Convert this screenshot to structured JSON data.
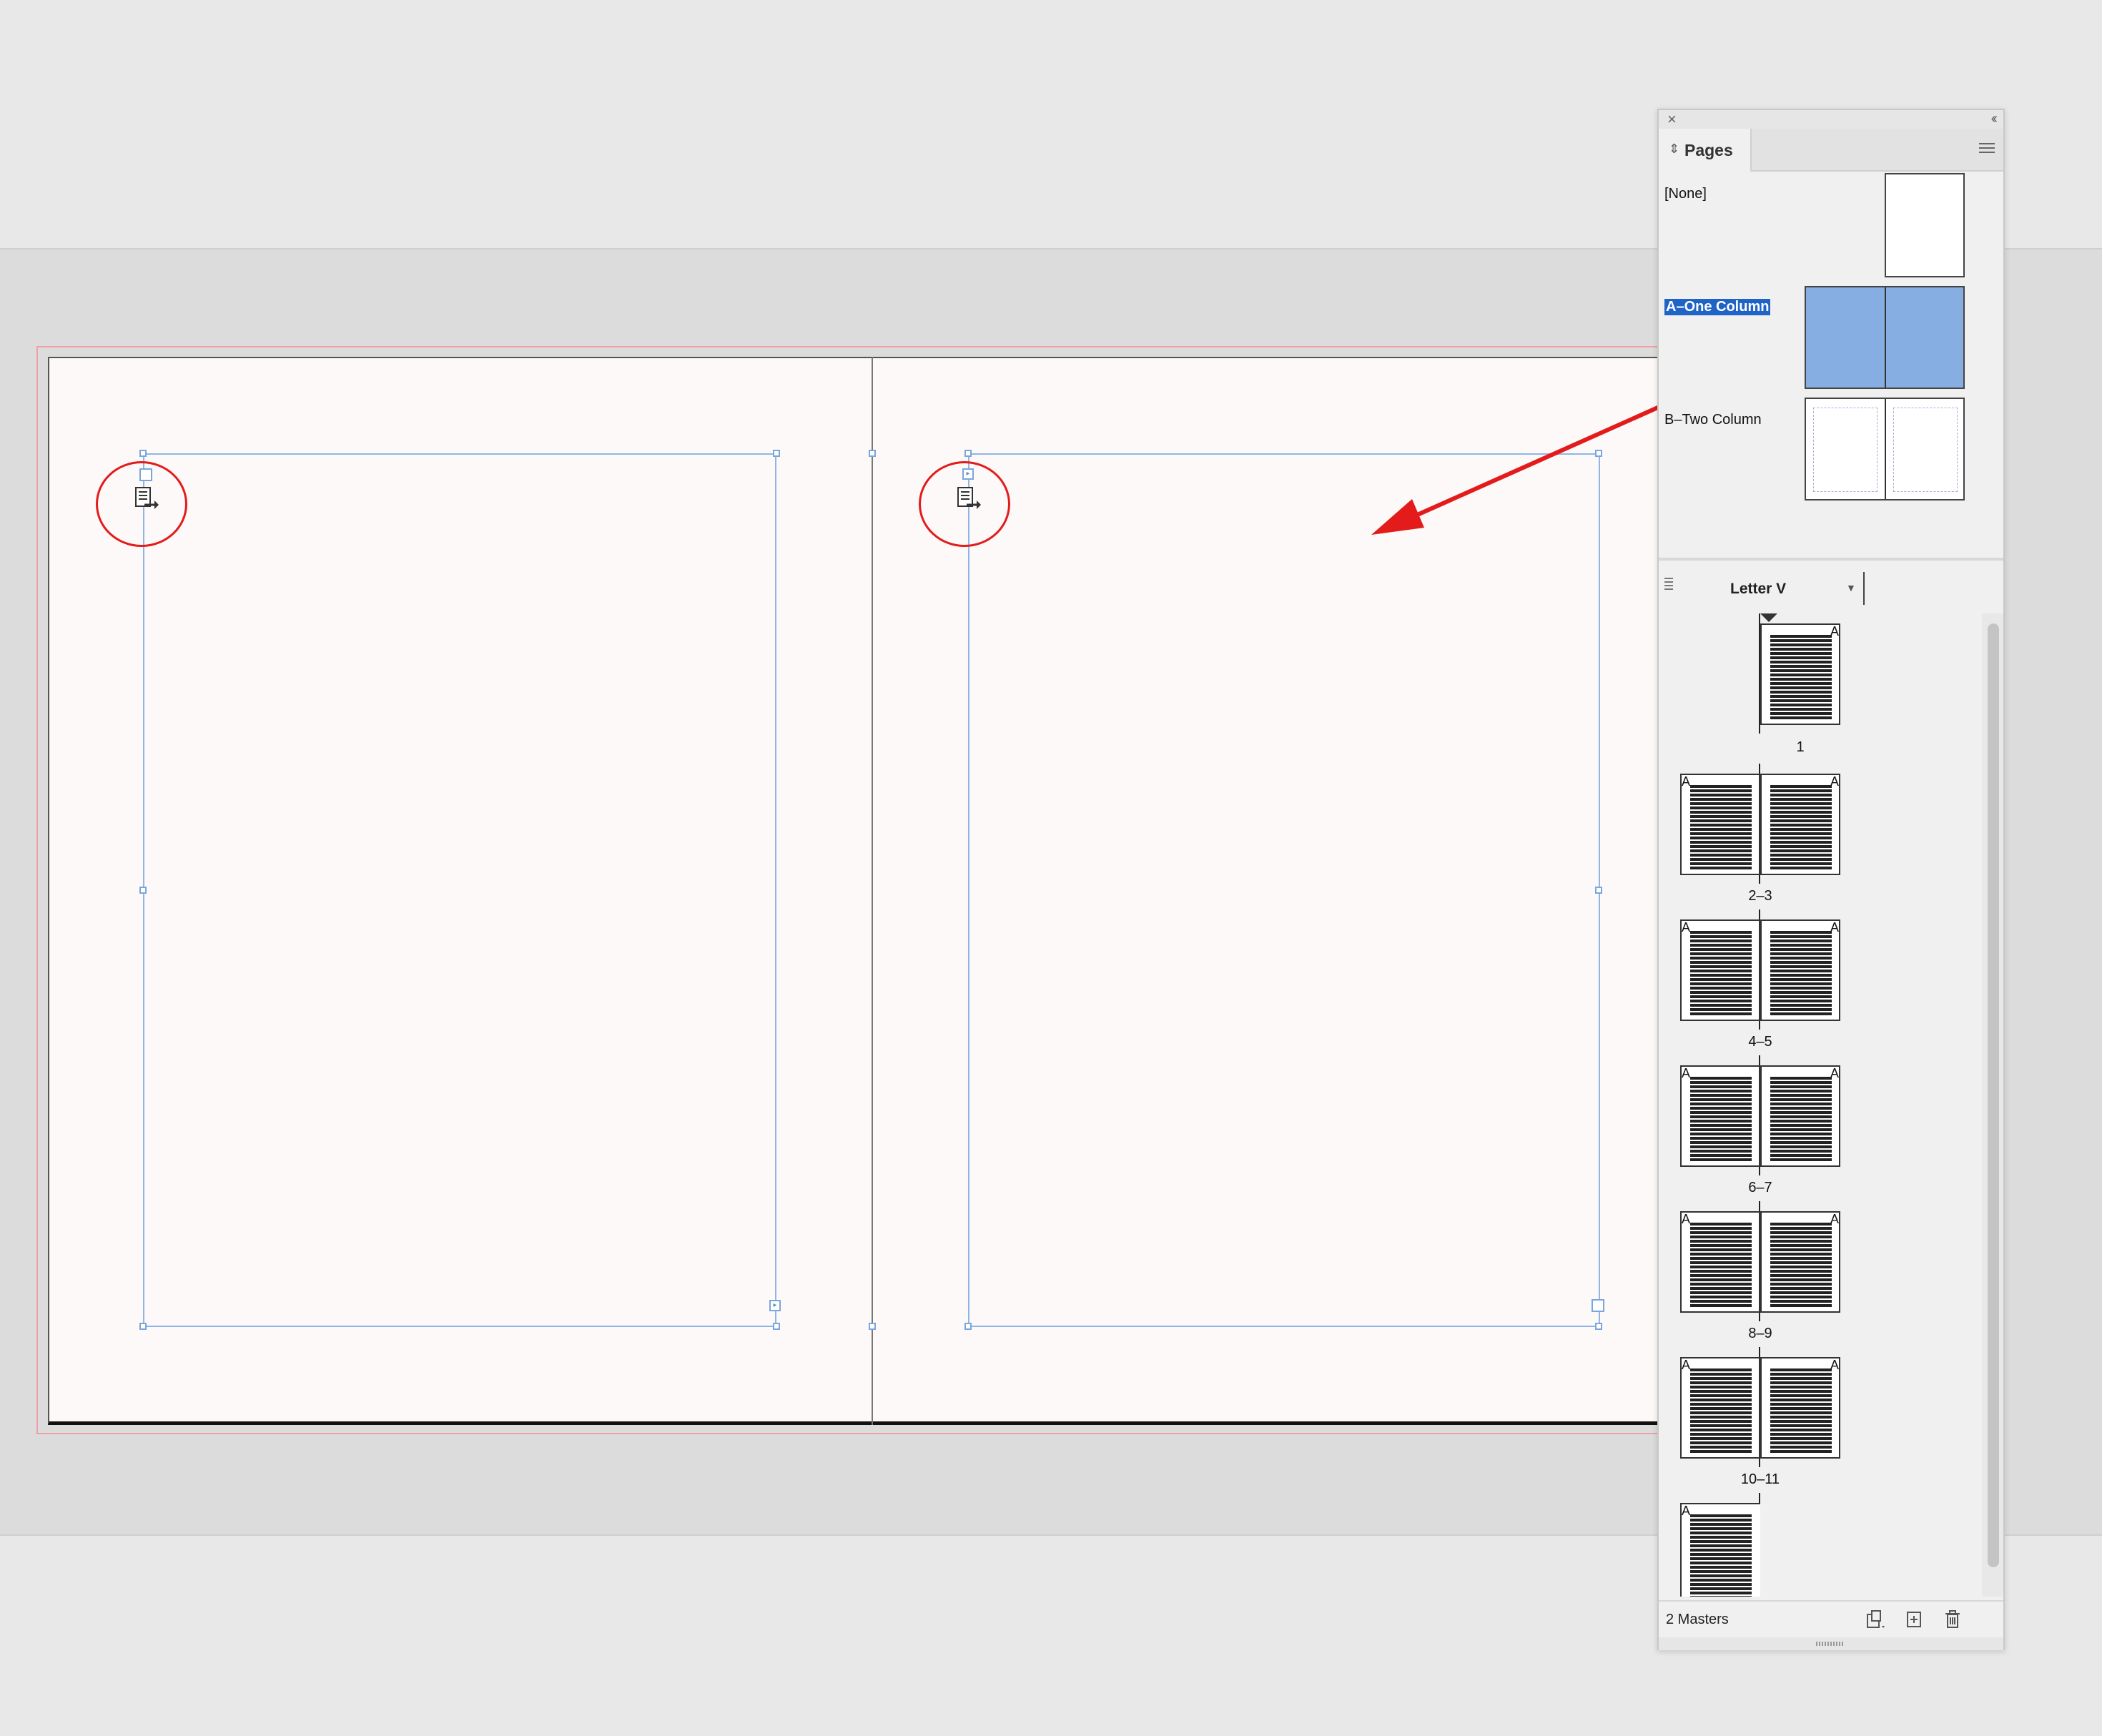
{
  "panel": {
    "title": "Pages",
    "masters": [
      {
        "label": "[None]",
        "selected": false
      },
      {
        "label": "A–One Column",
        "selected": true
      },
      {
        "label": "B–Two Column",
        "selected": false
      }
    ],
    "page_size": "Letter V",
    "pages": [
      {
        "label": "1",
        "masters": [
          "A"
        ]
      },
      {
        "label": "2–3",
        "masters": [
          "A",
          "A"
        ]
      },
      {
        "label": "4–5",
        "masters": [
          "A",
          "A"
        ]
      },
      {
        "label": "6–7",
        "masters": [
          "A",
          "A"
        ]
      },
      {
        "label": "8–9",
        "masters": [
          "A",
          "A"
        ]
      },
      {
        "label": "10–11",
        "masters": [
          "A",
          "A"
        ]
      },
      {
        "label": "",
        "masters": [
          "A"
        ]
      }
    ],
    "footer": "2 Masters"
  },
  "icons": {
    "close": "close-icon",
    "collapse": "double-chevron-left-icon",
    "panel_menu": "hamburger-menu-icon",
    "edit_size": "edit-page-size-icon",
    "new_page": "new-page-icon",
    "delete": "trash-icon"
  },
  "colors": {
    "selection": "#1f63c7",
    "master_fill": "#86aee2",
    "annotation": "#e31b1b",
    "frame": "#8fb6e6"
  }
}
